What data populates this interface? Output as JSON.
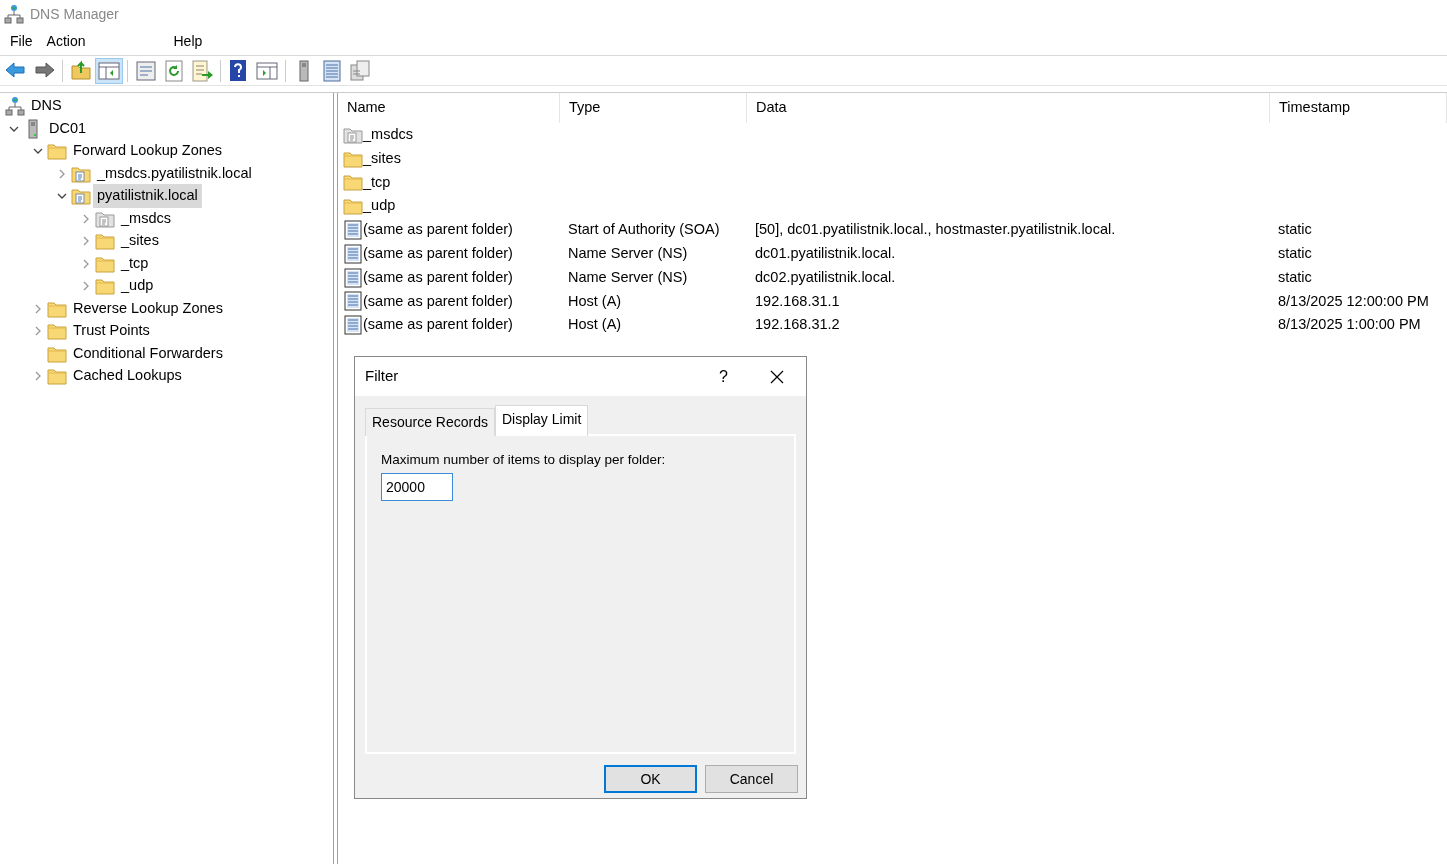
{
  "window": {
    "title": "DNS Manager"
  },
  "menu": [
    "File",
    "Action",
    "Help"
  ],
  "toolbar": [
    [
      {
        "kind": "back"
      },
      {
        "kind": "forward"
      }
    ],
    [
      {
        "kind": "up-folder",
        "pressed": false
      },
      {
        "kind": "show-tree",
        "pressed": true
      }
    ],
    [
      {
        "kind": "properties",
        "pressed": false
      },
      {
        "kind": "refresh",
        "pressed": false
      },
      {
        "kind": "export",
        "pressed": false
      }
    ],
    [
      {
        "kind": "help",
        "pressed": false
      },
      {
        "kind": "show-action",
        "pressed": false
      }
    ],
    [
      {
        "kind": "server",
        "pressed": false
      },
      {
        "kind": "record-list",
        "pressed": false
      },
      {
        "kind": "copy",
        "pressed": false
      }
    ]
  ],
  "tree": [
    {
      "label": "DNS",
      "kind": "dns",
      "selected": false,
      "children": [
        {
          "label": "DC01",
          "kind": "server",
          "expanded": true,
          "selected": false,
          "children": [
            {
              "label": "Forward Lookup Zones",
              "kind": "folder",
              "expanded": true,
              "selected": false,
              "children": [
                {
                  "label": "_msdcs.pyatilistnik.local",
                  "kind": "zone",
                  "expanded": false,
                  "selected": false
                },
                {
                  "label": "pyatilistnik.local",
                  "kind": "zone",
                  "expanded": true,
                  "selected": true,
                  "children": [
                    {
                      "label": "_msdcs",
                      "kind": "delegation",
                      "expanded": false,
                      "selected": false
                    },
                    {
                      "label": "_sites",
                      "kind": "folder",
                      "expanded": false,
                      "selected": false
                    },
                    {
                      "label": "_tcp",
                      "kind": "folder",
                      "expanded": false,
                      "selected": false
                    },
                    {
                      "label": "_udp",
                      "kind": "folder",
                      "expanded": false,
                      "selected": false
                    }
                  ]
                }
              ]
            },
            {
              "label": "Reverse Lookup Zones",
              "kind": "folder",
              "expanded": false,
              "selected": false
            },
            {
              "label": "Trust Points",
              "kind": "folder",
              "expanded": false,
              "selected": false
            },
            {
              "label": "Conditional Forwarders",
              "kind": "folder",
              "selected": false
            },
            {
              "label": "Cached Lookups",
              "kind": "folder",
              "expanded": false,
              "selected": false
            }
          ]
        }
      ]
    }
  ],
  "list": {
    "columns": [
      "Name",
      "Type",
      "Data",
      "Timestamp"
    ],
    "rows": [
      {
        "kind": "delegation",
        "name": "_msdcs"
      },
      {
        "kind": "folder",
        "name": "_sites"
      },
      {
        "kind": "folder",
        "name": "_tcp"
      },
      {
        "kind": "folder",
        "name": "_udp"
      },
      {
        "kind": "record",
        "name": "(same as parent folder)",
        "type": "Start of Authority (SOA)",
        "data": "[50], dc01.pyatilistnik.local., hostmaster.pyatilistnik.local.",
        "timestamp": "static"
      },
      {
        "kind": "record",
        "name": "(same as parent folder)",
        "type": "Name Server (NS)",
        "data": "dc01.pyatilistnik.local.",
        "timestamp": "static"
      },
      {
        "kind": "record",
        "name": "(same as parent folder)",
        "type": "Name Server (NS)",
        "data": "dc02.pyatilistnik.local.",
        "timestamp": "static"
      },
      {
        "kind": "record",
        "name": "(same as parent folder)",
        "type": "Host (A)",
        "data": "192.168.31.1",
        "timestamp": "8/13/2025 12:00:00 PM"
      },
      {
        "kind": "record",
        "name": "(same as parent folder)",
        "type": "Host (A)",
        "data": "192.168.31.2",
        "timestamp": "8/13/2025 1:00:00 PM"
      }
    ]
  },
  "dialog": {
    "title": "Filter",
    "help": "?",
    "tabs": [
      {
        "label": "Resource Records",
        "selected": false
      },
      {
        "label": "Display Limit",
        "selected": true
      }
    ],
    "field_label": "Maximum number of items to display per folder:",
    "field_value": "20000",
    "buttons": [
      {
        "label": "OK",
        "default": true
      },
      {
        "label": "Cancel",
        "default": false
      }
    ]
  }
}
